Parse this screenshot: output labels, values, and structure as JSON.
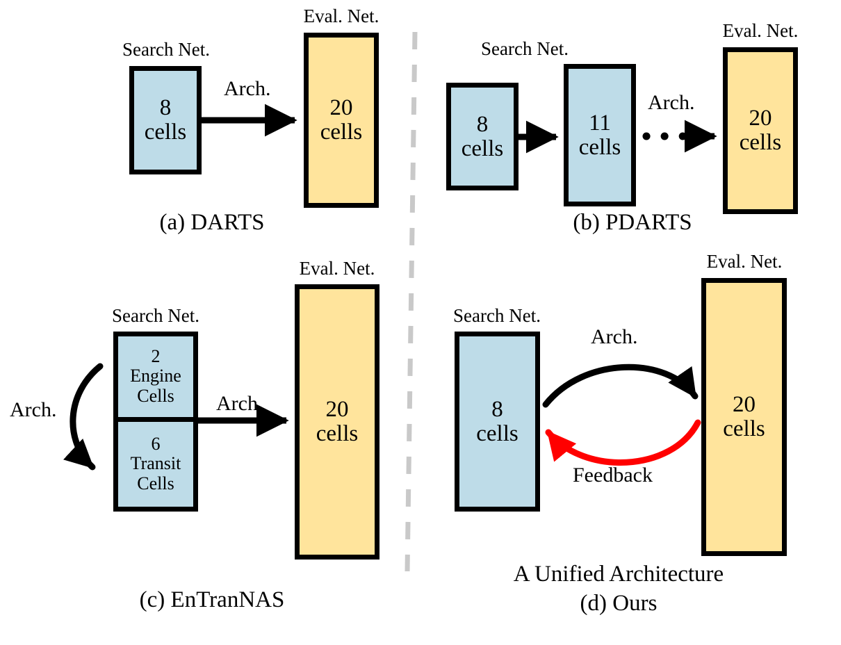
{
  "figure": {
    "colors": {
      "search_net_fill": "#bedce8",
      "eval_net_fill": "#ffe49c",
      "outline": "#000000",
      "feedback_arrow": "#ff0000",
      "divider": "#cccccc",
      "background": "#ffffff"
    }
  },
  "panels": {
    "a": {
      "caption": "(a) DARTS",
      "search_net_label": "Search Net.",
      "eval_net_label": "Eval. Net.",
      "arrow_label": "Arch.",
      "search_box": {
        "count": "8",
        "unit": "cells"
      },
      "eval_box": {
        "count": "20",
        "unit": "cells"
      }
    },
    "b": {
      "caption": "(b) PDARTS",
      "search_net_label": "Search Net.",
      "eval_net_label": "Eval. Net.",
      "arrow_label": "Arch.",
      "search_box_1": {
        "count": "8",
        "unit": "cells"
      },
      "search_box_2": {
        "count": "11",
        "unit": "cells"
      },
      "eval_box": {
        "count": "20",
        "unit": "cells"
      }
    },
    "c": {
      "caption": "(c) EnTranNAS",
      "search_net_label": "Search Net.",
      "eval_net_label": "Eval. Net.",
      "arrow_label_left": "Arch.",
      "arrow_label_right": "Arch.",
      "search_box_top": {
        "count": "2",
        "line2": "Engine",
        "line3": "Cells"
      },
      "search_box_bottom": {
        "count": "6",
        "line2": "Transit",
        "line3": "Cells"
      },
      "eval_box": {
        "count": "20",
        "unit": "cells"
      }
    },
    "d": {
      "caption_line1": "A Unified Architecture",
      "caption_line2": "(d) Ours",
      "search_net_label": "Search Net.",
      "eval_net_label": "Eval. Net.",
      "arrow_label_top": "Arch.",
      "arrow_label_bottom": "Feedback",
      "search_box": {
        "count": "8",
        "unit": "cells"
      },
      "eval_box": {
        "count": "20",
        "unit": "cells"
      }
    }
  }
}
